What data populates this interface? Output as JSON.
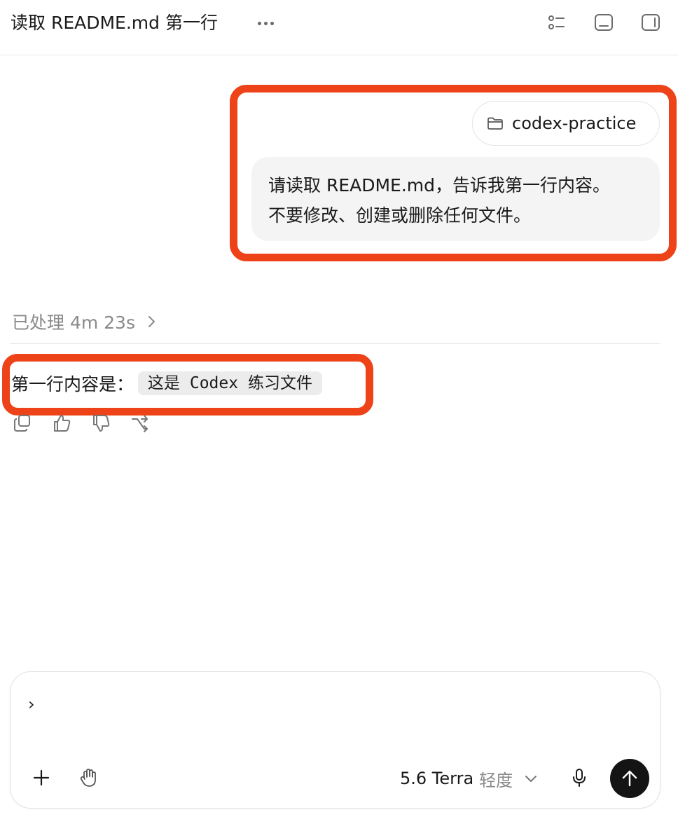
{
  "header": {
    "title": "读取 README.md 第一行",
    "more_icon": "more-dots-icon",
    "icons": [
      "list-icon",
      "bottom-panel-icon",
      "side-panel-icon"
    ]
  },
  "user_message": {
    "workspace_chip": "codex-practice",
    "lines": [
      "请读取 README.md，告诉我第一行内容。",
      "不要修改、创建或删除任何文件。"
    ]
  },
  "processing": {
    "label": "已处理 4m 23s"
  },
  "assistant_message": {
    "lead": "第一行内容是：",
    "code": "这是 Codex 练习文件"
  },
  "message_actions": [
    "copy-icon",
    "thumbs-up-icon",
    "thumbs-down-icon",
    "branch-icon"
  ],
  "composer": {
    "prompt_text": "›",
    "model_name": "5.6 Terra",
    "reasoning_level": "轻度"
  },
  "colors": {
    "highlight": "#ee4218",
    "bubble_bg": "#f3f4f3",
    "send_bg": "#141414"
  }
}
